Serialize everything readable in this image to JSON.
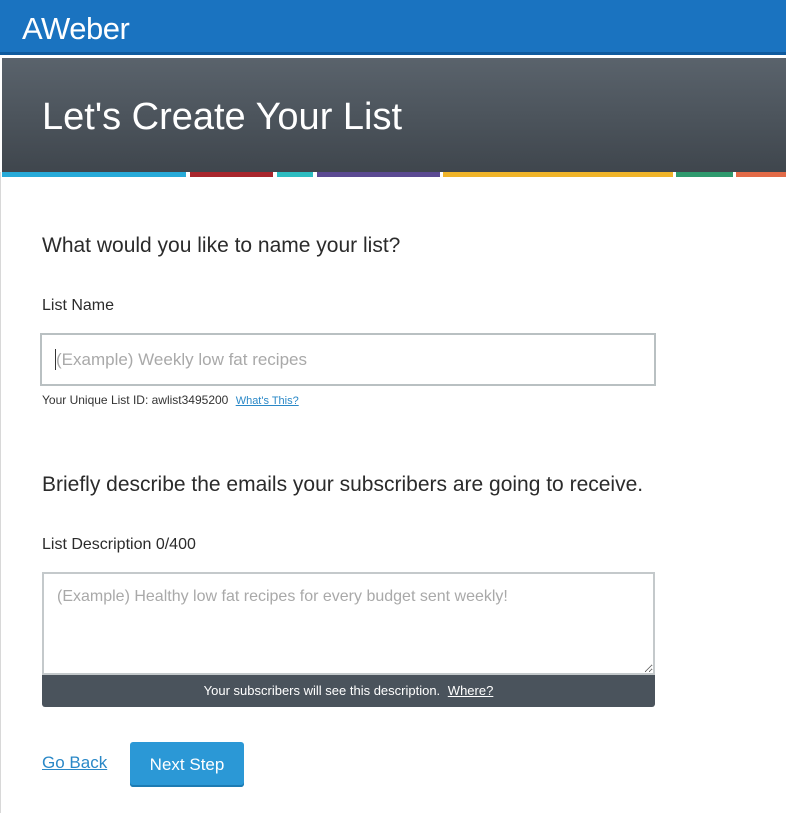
{
  "brand": {
    "logo_text": "AWeber",
    "bar_color": "#1a73c0"
  },
  "hero": {
    "title": "Let's Create Your List"
  },
  "stripes": [
    {
      "color": "#27aad8"
    },
    {
      "color": "#a8262c"
    },
    {
      "color": "#2dbdc1"
    },
    {
      "color": "#5b4a92"
    },
    {
      "color": "#f0b429"
    },
    {
      "color": "#2f9a6e"
    },
    {
      "color": "#e26a47"
    }
  ],
  "name_section": {
    "question": "What would you like to name your list?",
    "label": "List Name",
    "value": "",
    "placeholder": "(Example) Weekly low fat recipes",
    "list_id_text": "Your Unique List ID: awlist3495200",
    "whats_this_link": "What's This?"
  },
  "desc_section": {
    "question": "Briefly describe the emails your subscribers are going to receive.",
    "label": "List Description 0/400",
    "value": "",
    "placeholder": "(Example) Healthy low fat recipes for every budget sent weekly!",
    "note_text": "Your subscribers will see this description.",
    "note_link": "Where?"
  },
  "actions": {
    "go_back": "Go Back",
    "next_step": "Next Step",
    "accent_color": "#2b98d6"
  }
}
